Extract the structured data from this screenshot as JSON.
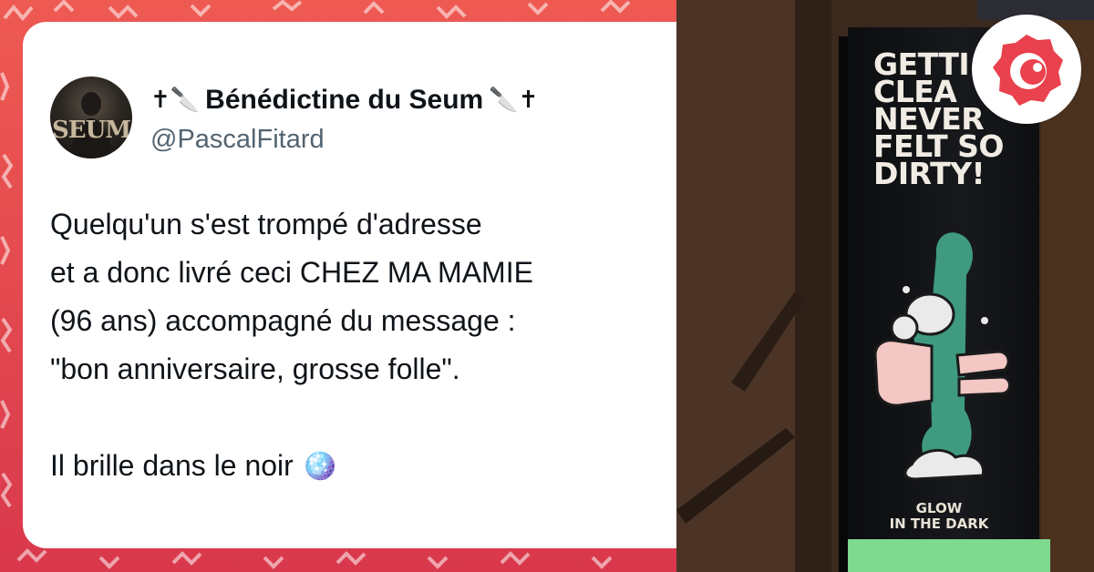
{
  "tweet": {
    "avatar_text": "SEUM",
    "display_name": "Bénédictine du Seum",
    "name_prefix_emojis": "✝🔪",
    "name_suffix_emojis": "🔪✝",
    "handle": "@PascalFitard",
    "lines": [
      "Quelqu'un s'est trompé d'adresse",
      "et a donc livré ceci CHEZ MA MAMIE",
      "(96 ans) accompagné du message :",
      "\"bon anniversaire, grosse folle\"."
    ],
    "last_line": "Il brille dans le noir",
    "last_emoji": "🪩"
  },
  "photo": {
    "box_headline": [
      "GETTI",
      "CLEA",
      "NEVER",
      "FELT SO",
      "DIRTY!"
    ],
    "box_footer": [
      "GLOW",
      "IN THE DARK"
    ]
  },
  "colors": {
    "background": "#e24a4e",
    "card": "#ffffff",
    "text": "#0f1419",
    "handle": "#536471",
    "badge_accent": "#e9414d",
    "box_toy": "#3f9a80",
    "box_hand": "#f2c7c4",
    "box_strip": "#7fd98e"
  },
  "icons": [
    "dagger-icon",
    "knife-icon",
    "mirror-ball-icon",
    "site-logo-icon"
  ]
}
